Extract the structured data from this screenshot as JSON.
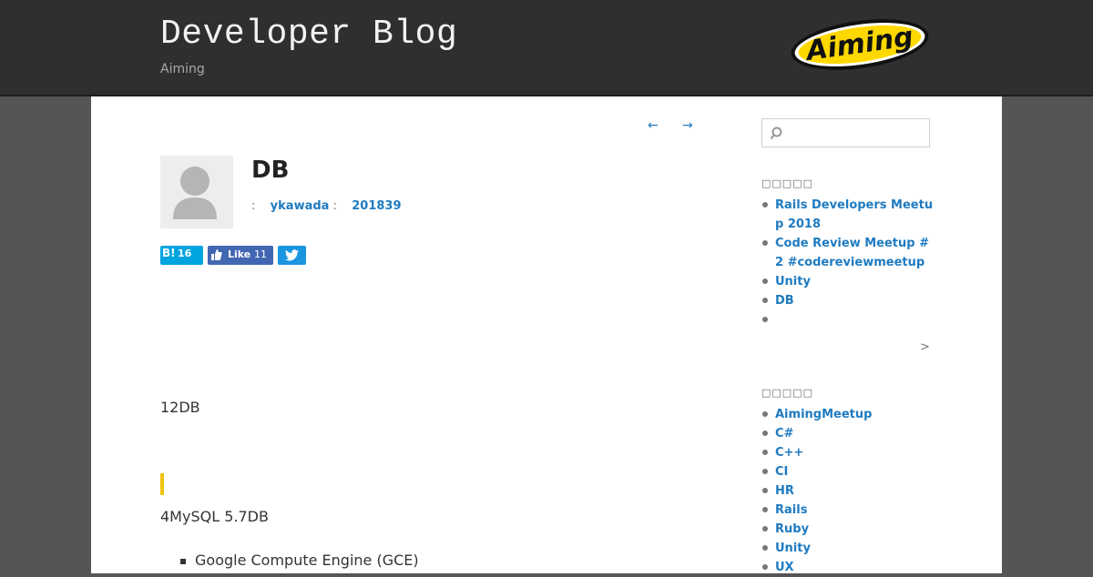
{
  "header": {
    "site_title": "Developer Blog",
    "site_desc": "Aiming",
    "logo_text": "Aiming"
  },
  "nav": {
    "prev": "←",
    "next": "→"
  },
  "post": {
    "title": "DB",
    "meta_sep1": ":",
    "author": "ykawada",
    "meta_sep2": ":",
    "date": "201839",
    "share": {
      "hatena_label": "B!",
      "hatena_count": "16",
      "like_label": "Like",
      "like_count": "11"
    },
    "paragraph1": "12DB",
    "paragraph2": "4MySQL 5.7DB",
    "list_items": [
      "Google Compute Engine (GCE)"
    ]
  },
  "sidebar": {
    "search_placeholder": "",
    "recent_title": "□□□□□",
    "recent_items": [
      "Rails Developers Meetu",
      "p 2018",
      "Code Review Meetup #",
      "2 #codereviewmeetup",
      "Unity",
      "DB",
      ""
    ],
    "more": ">",
    "tags_title": "□□□□□",
    "tag_items": [
      "AimingMeetup",
      "C#",
      "C++",
      "CI",
      "HR",
      "Rails",
      "Ruby",
      "Unity",
      "UX"
    ]
  },
  "colors": {
    "header_bg": "#2f2f2f",
    "page_bg": "#555555",
    "link": "#1f7bc1",
    "accent_bar": "#f1c40f",
    "logo_yellow": "#ffd800"
  }
}
